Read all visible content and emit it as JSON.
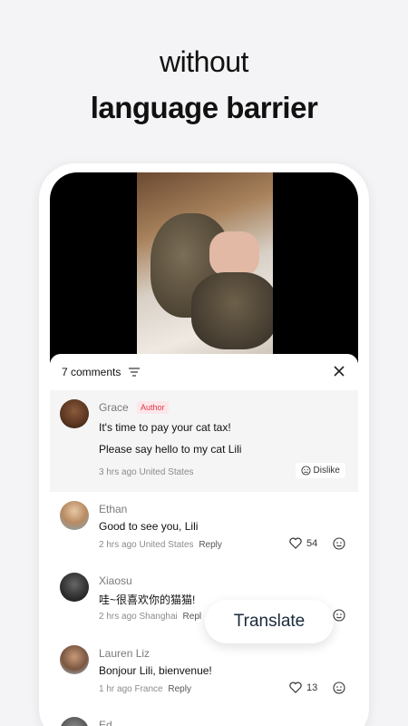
{
  "headline": {
    "line1": "without",
    "line2": "language barrier"
  },
  "comments_sheet": {
    "count_label": "7 comments",
    "comments": [
      {
        "name": "Grace",
        "badge": "Author",
        "lines": [
          "It's time to pay your cat tax!",
          "Please say hello to my cat Lili"
        ],
        "time": "3 hrs ago",
        "location": "United States",
        "dislike_label": "Dislike"
      },
      {
        "name": "Ethan",
        "text": "Good to see you, Lili",
        "time": "2 hrs ago",
        "location": "United States",
        "reply": "Reply",
        "likes": "54"
      },
      {
        "name": "Xiaosu",
        "text": "哇~很喜欢你的猫猫!",
        "time": "2 hrs ago",
        "location": "Shanghai",
        "reply": "Repl"
      },
      {
        "name": "Lauren Liz",
        "text": "Bonjour Lili, bienvenue!",
        "time": "1 hr ago",
        "location": "France",
        "reply": "Reply",
        "likes": "13"
      },
      {
        "name": "Ed"
      }
    ]
  },
  "translate_button": {
    "label": "Translate"
  },
  "colors": {
    "author_badge": "#e0344a",
    "background": "#f4f4f6"
  }
}
